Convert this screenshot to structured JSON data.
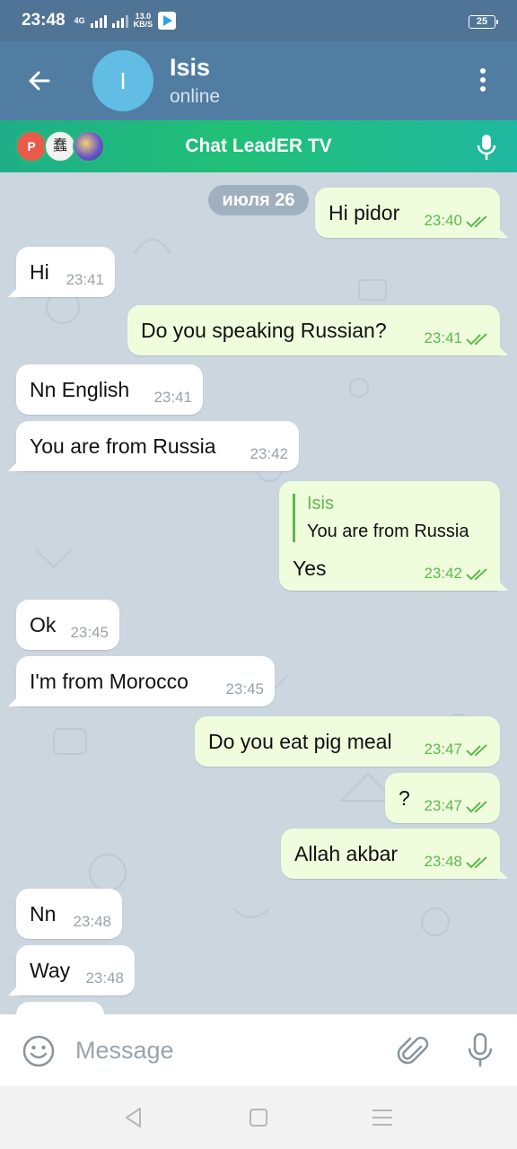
{
  "status_bar": {
    "time": "23:48",
    "network": "4G",
    "speed_value": "13.0",
    "speed_unit": "KB/S",
    "battery": "25"
  },
  "header": {
    "avatar_letter": "I",
    "name": "Isis",
    "status": "online"
  },
  "voice_chat": {
    "title": "Chat LeadER TV",
    "avatar_letters": [
      "P",
      "蠢"
    ]
  },
  "date_badge": "июля 26",
  "messages": [
    {
      "dir": "out",
      "text": "Hi pidor",
      "time": "23:40"
    },
    {
      "dir": "in",
      "text": "Hi",
      "time": "23:41"
    },
    {
      "dir": "out",
      "text": "Do you speaking Russian?",
      "time": "23:41"
    },
    {
      "dir": "in",
      "text": "Nn English",
      "time": "23:41"
    },
    {
      "dir": "in",
      "text": "You are from Russia",
      "time": "23:42"
    },
    {
      "dir": "out",
      "reply_author": "Isis",
      "reply_text": "You are from Russia",
      "text": "Yes",
      "time": "23:42"
    },
    {
      "dir": "in",
      "text": "Ok",
      "time": "23:45"
    },
    {
      "dir": "in",
      "text": "I'm from Morocco",
      "time": "23:45"
    },
    {
      "dir": "out",
      "text": "Do you eat pig meal",
      "time": "23:47"
    },
    {
      "dir": "out",
      "text": "?",
      "time": "23:47"
    },
    {
      "dir": "out",
      "text": "Allah akbar",
      "time": "23:48"
    },
    {
      "dir": "in",
      "text": "Nn",
      "time": "23:48"
    },
    {
      "dir": "in",
      "text": "Way",
      "time": "23:48"
    }
  ],
  "input": {
    "placeholder": "Message",
    "value": ""
  },
  "colors": {
    "header": "#517da2",
    "outgoing_bubble": "#effddd",
    "incoming_bubble": "#ffffff",
    "check_color": "#5fb84f",
    "voice_bar_green": "#21c077"
  },
  "icons": [
    "back-arrow-icon",
    "more-vert-icon",
    "microphone-icon",
    "emoji-icon",
    "attach-icon",
    "double-check-icon"
  ]
}
